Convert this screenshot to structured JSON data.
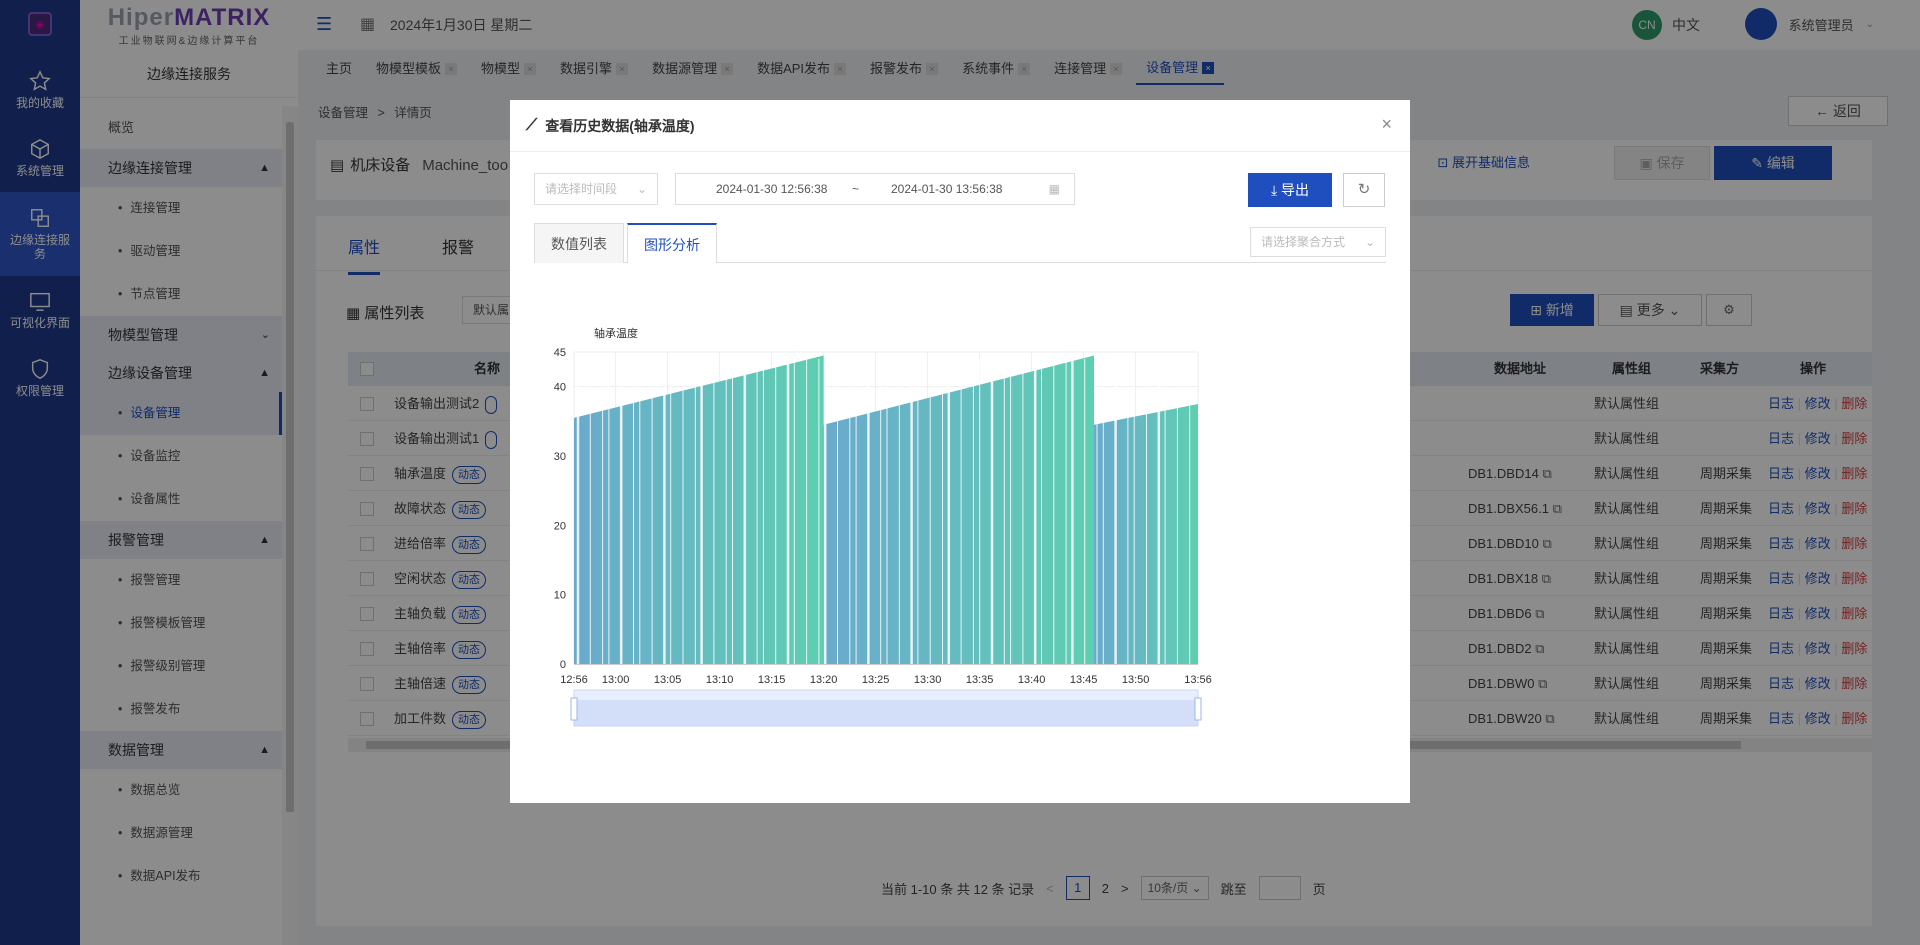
{
  "brand": {
    "name_a": "Hiper",
    "name_b": "MATRIX",
    "subtitle": "工业物联网&边缘计算平台"
  },
  "rail": [
    {
      "label": "我的收藏",
      "icon": "star-icon"
    },
    {
      "label": "系统管理",
      "icon": "cube-icon"
    },
    {
      "label": "边缘连接服务",
      "icon": "edge-service-icon",
      "active": true
    },
    {
      "label": "可视化界面",
      "icon": "visual-screen-icon"
    },
    {
      "label": "权限管理",
      "icon": "shield-icon"
    }
  ],
  "menu": {
    "title": "边缘连接服务",
    "overview": "概览",
    "groups": [
      {
        "label": "边缘连接管理",
        "items": [
          "连接管理",
          "驱动管理",
          "节点管理"
        ]
      },
      {
        "label": "物模型管理",
        "items": []
      },
      {
        "label": "边缘设备管理",
        "items": [
          "设备管理",
          "设备监控",
          "设备属性"
        ]
      },
      {
        "label": "报警管理",
        "items": [
          "报警管理",
          "报警模板管理",
          "报警级别管理",
          "报警发布"
        ]
      },
      {
        "label": "数据管理",
        "items": [
          "数据总览",
          "数据源管理",
          "数据API发布"
        ]
      }
    ]
  },
  "topbar": {
    "date": "2024年1月30日 星期二",
    "lang_badge": "CN",
    "lang": "中文",
    "user": "系统管理员"
  },
  "tabs": [
    "主页",
    "物模型模板",
    "物模型",
    "数据引擎",
    "数据源管理",
    "数据API发布",
    "报警发布",
    "系统事件",
    "连接管理",
    "设备管理"
  ],
  "breadcrumb": {
    "a": "设备管理",
    "sep": ">",
    "b": "详情页"
  },
  "back": "返回",
  "device": {
    "title": "机床设备",
    "code": "Machine_too",
    "expand": "展开基础信息",
    "save": "保存",
    "edit": "编辑"
  },
  "inner_tabs": [
    "属性",
    "报警"
  ],
  "list": {
    "title": "属性列表",
    "group_sel": "默认属",
    "new": "新增",
    "more": "更多"
  },
  "table": {
    "headers": [
      "名称",
      "数据地址",
      "属性组",
      "采集方",
      "操作"
    ],
    "rows": [
      {
        "name": "设备输出测试2",
        "tag": "",
        "addr": "",
        "group": "默认属性组",
        "mode": ""
      },
      {
        "name": "设备输出测试1",
        "tag": "",
        "addr": "",
        "group": "默认属性组",
        "mode": ""
      },
      {
        "name": "轴承温度",
        "tag": "动态",
        "addr": "DB1.DBD14",
        "group": "默认属性组",
        "mode": "周期采集"
      },
      {
        "name": "故障状态",
        "tag": "动态",
        "addr": "DB1.DBX56.1",
        "group": "默认属性组",
        "mode": "周期采集"
      },
      {
        "name": "进给倍率",
        "tag": "动态",
        "addr": "DB1.DBD10",
        "group": "默认属性组",
        "mode": "周期采集"
      },
      {
        "name": "空闲状态",
        "tag": "动态",
        "addr": "DB1.DBX18",
        "group": "默认属性组",
        "mode": "周期采集"
      },
      {
        "name": "主轴负载",
        "tag": "动态",
        "addr": "DB1.DBD6",
        "group": "默认属性组",
        "mode": "周期采集"
      },
      {
        "name": "主轴倍率",
        "tag": "动态",
        "addr": "DB1.DBD2",
        "group": "默认属性组",
        "mode": "周期采集"
      },
      {
        "name": "主轴倍速",
        "tag": "动态",
        "addr": "DB1.DBW0",
        "group": "默认属性组",
        "mode": "周期采集"
      },
      {
        "name": "加工件数",
        "tag": "动态",
        "addr": "DB1.DBW20",
        "group": "默认属性组",
        "mode": "周期采集"
      }
    ],
    "ops": {
      "log": "日志",
      "edit": "修改",
      "del": "删除"
    }
  },
  "pager": {
    "summary": "当前 1-10 条 共 12 条 记录",
    "prev": "<",
    "p1": "1",
    "p2": "2",
    "next": ">",
    "size": "10条/页",
    "goto": "跳至",
    "page": "页"
  },
  "modal": {
    "title": "查看历史数据(轴承温度)",
    "close": "×",
    "time_placeholder": "请选择时间段",
    "start": "2024-01-30 12:56:38",
    "tilde": "~",
    "end": "2024-01-30 13:56:38",
    "export": "导出",
    "tabs": [
      "数值列表",
      "图形分析"
    ],
    "agg_placeholder": "请选择聚合方式"
  },
  "chart_data": {
    "type": "bar",
    "title": "轴承温度",
    "x_ticks": [
      "12:56",
      "13:00",
      "13:05",
      "13:10",
      "13:15",
      "13:20",
      "13:25",
      "13:30",
      "13:35",
      "13:40",
      "13:45",
      "13:50",
      "13:56"
    ],
    "y_ticks": [
      0,
      10,
      20,
      30,
      40,
      45
    ],
    "ylim": [
      0,
      45
    ],
    "series": [
      {
        "segments": [
          {
            "from": "12:56",
            "to": "13:20",
            "start": 35.5,
            "end": 44.5
          },
          {
            "from": "13:20",
            "to": "13:46",
            "start": 34.5,
            "end": 44.5
          },
          {
            "from": "13:46",
            "to": "13:56",
            "start": 34.5,
            "end": 37.5
          }
        ]
      }
    ],
    "colors": {
      "start": "#6aaacd",
      "end": "#5ecfb1"
    },
    "datazoom": true
  }
}
